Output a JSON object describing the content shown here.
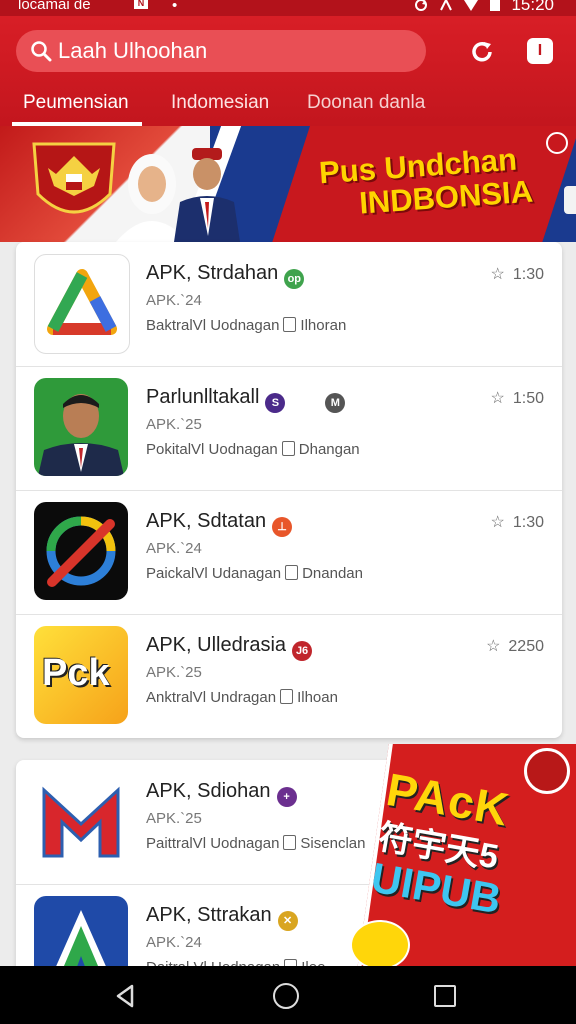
{
  "status_bar": {
    "carrier": "locamai de",
    "n_icon": "N",
    "dot": "•",
    "time": "15:20",
    "icons": [
      "sync-icon",
      "signal-icon",
      "wifi-icon",
      "battery-icon"
    ]
  },
  "header": {
    "search_placeholder": "Laah Ulhoohan",
    "refresh_icon": "refresh-icon",
    "info_icon": "info-icon",
    "info_label": "I"
  },
  "tabs": [
    {
      "label": "Peumensian",
      "active": true
    },
    {
      "label": "Indomesian",
      "active": false
    },
    {
      "label": "Doonan danla",
      "active": false
    }
  ],
  "banner": {
    "title_line1": "Pus Undchan",
    "title_line2": "INDBONSIA"
  },
  "apps": [
    {
      "title": "APK, Strdahan",
      "version": "APK.`24",
      "meta_left": "BaktralVl Uodnagan",
      "meta_right": "Ilhoran",
      "rating": "1:30",
      "badge_color": "#3fa34d",
      "badge_text": "op"
    },
    {
      "title": "Parlunlltakall",
      "version": "APK.`25",
      "meta_left": "PokitalVl Uodnagan",
      "meta_right": "Dhangan",
      "rating": "1:50",
      "badge_color": "#4b2a8a",
      "badge_text": "S"
    },
    {
      "title": "APK, Sdtatan",
      "version": "APK.`24",
      "meta_left": "PaickalVl Udanagan",
      "meta_right": "Dnandan",
      "rating": "1:30",
      "badge_color": "#e8562a",
      "badge_text": "⊥"
    },
    {
      "title": "APK, Ulledrasia",
      "version": "APK.`25",
      "meta_left": "AnktralVl Undragan",
      "meta_right": "Ilhoan",
      "rating": "2250",
      "badge_color": "#c0262c",
      "badge_text": "J6"
    },
    {
      "title": "APK, Sdiohan",
      "version": "APK.`25",
      "meta_left": "PaittralVl Uodnagan",
      "meta_right": "Sisenclan",
      "rating": "",
      "badge_color": "#6b2f8f",
      "badge_text": "+"
    },
    {
      "title": "APK, Sttrakan",
      "version": "APK.`24",
      "meta_left": "Daitral Vl Uodnagan",
      "meta_right": "Ileo",
      "rating": "",
      "badge_color": "#d9a520",
      "badge_text": "✕"
    }
  ],
  "second_badge_text": "M",
  "promo": {
    "line1": "PAcK",
    "line2": "符宇天5",
    "line3": "UIPUB"
  },
  "icon_labels": {
    "app4_logo": "Pck"
  },
  "colors": {
    "brand_red": "#c8181e",
    "banner_blue": "#1a3a8f",
    "promo_yellow": "#ffd60a"
  }
}
